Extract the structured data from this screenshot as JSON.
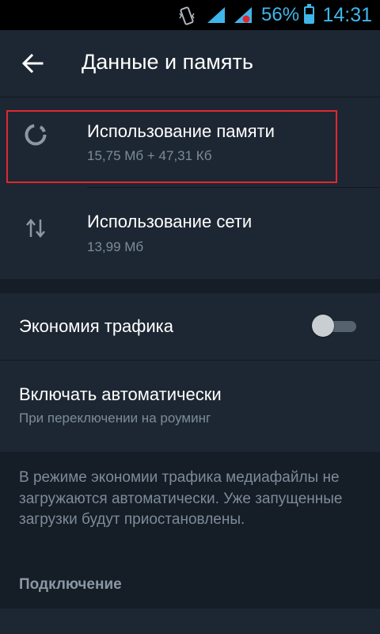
{
  "status_bar": {
    "battery_percent": "56%",
    "battery_level": 0.56,
    "time": "14:31",
    "icons": [
      "vibrate-icon",
      "signal-icon",
      "signal-icon",
      "battery-icon"
    ]
  },
  "app_bar": {
    "back_icon": "arrow-back-icon",
    "title": "Данные и память"
  },
  "usage": {
    "storage": {
      "icon": "storage-usage-icon",
      "title": "Использование памяти",
      "value": "15,75 Мб + 47,31 Кб"
    },
    "network": {
      "icon": "network-usage-icon",
      "title": "Использование сети",
      "value": "13,99 Мб"
    }
  },
  "data_saver": {
    "label": "Экономия трафика",
    "enabled": false,
    "auto_enable": {
      "label": "Включать автоматически",
      "value": "При переключении на роуминг"
    },
    "info": "В режиме экономии трафика медиафайлы не загружаются автоматически. Уже запущенные загрузки будут приостановлены.",
    "next_section_header": "Подключение"
  },
  "colors": {
    "background": "#1d2733",
    "section_gap": "#151d27",
    "accent": "#3fb6ea",
    "highlight_border": "#e0272f",
    "secondary_text": "#7d8b99"
  }
}
